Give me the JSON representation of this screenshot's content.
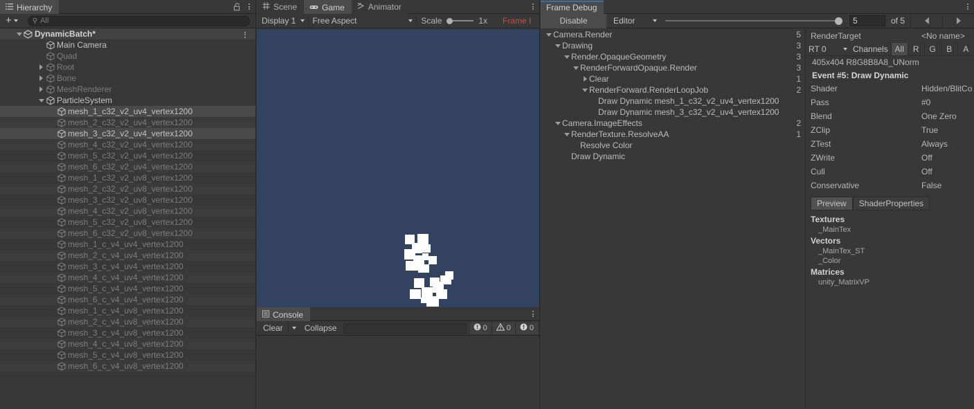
{
  "hierarchy": {
    "tab_label": "Hierarchy",
    "tab_icon": "hierarchy-icon",
    "lock_icon": "lock-icon",
    "menu_icon": "kebab-icon",
    "add_label": "+",
    "search_placeholder": "All",
    "search_value": "",
    "items": [
      {
        "label": "DynamicBatch*",
        "depth": 0,
        "twisty": "down",
        "icon": "scene-icon",
        "state": "root",
        "bold": true,
        "kebab": true
      },
      {
        "label": "Main Camera",
        "depth": 2,
        "twisty": "none",
        "icon": "cube-icon",
        "state": "normal"
      },
      {
        "label": "Quad",
        "depth": 2,
        "twisty": "none",
        "icon": "cube-icon",
        "state": "dim"
      },
      {
        "label": "Root",
        "depth": 2,
        "twisty": "right",
        "icon": "cube-icon",
        "state": "dim"
      },
      {
        "label": "Bone",
        "depth": 2,
        "twisty": "right",
        "icon": "cube-icon",
        "state": "dim"
      },
      {
        "label": "MeshRenderer",
        "depth": 2,
        "twisty": "right",
        "icon": "cube-icon",
        "state": "dim"
      },
      {
        "label": "ParticleSystem",
        "depth": 2,
        "twisty": "down",
        "icon": "cube-icon",
        "state": "normal"
      },
      {
        "label": "mesh_1_c32_v2_uv4_vertex1200",
        "depth": 3,
        "twisty": "none",
        "icon": "cube-icon",
        "state": "sel"
      },
      {
        "label": "mesh_2_c32_v2_uv4_vertex1200",
        "depth": 3,
        "twisty": "none",
        "icon": "cube-icon",
        "state": "dim-zebra"
      },
      {
        "label": "mesh_3_c32_v2_uv4_vertex1200",
        "depth": 3,
        "twisty": "none",
        "icon": "cube-icon",
        "state": "sel"
      },
      {
        "label": "mesh_4_c32_v2_uv4_vertex1200",
        "depth": 3,
        "twisty": "none",
        "icon": "cube-icon",
        "state": "dim-zebra"
      },
      {
        "label": "mesh_5_c32_v2_uv4_vertex1200",
        "depth": 3,
        "twisty": "none",
        "icon": "cube-icon",
        "state": "dim"
      },
      {
        "label": "mesh_6_c32_v2_uv4_vertex1200",
        "depth": 3,
        "twisty": "none",
        "icon": "cube-icon",
        "state": "dim-zebra"
      },
      {
        "label": "mesh_1_c32_v2_uv8_vertex1200",
        "depth": 3,
        "twisty": "none",
        "icon": "cube-icon",
        "state": "dim"
      },
      {
        "label": "mesh_2_c32_v2_uv8_vertex1200",
        "depth": 3,
        "twisty": "none",
        "icon": "cube-icon",
        "state": "dim-zebra"
      },
      {
        "label": "mesh_3_c32_v2_uv8_vertex1200",
        "depth": 3,
        "twisty": "none",
        "icon": "cube-icon",
        "state": "dim"
      },
      {
        "label": "mesh_4_c32_v2_uv8_vertex1200",
        "depth": 3,
        "twisty": "none",
        "icon": "cube-icon",
        "state": "dim-zebra"
      },
      {
        "label": "mesh_5_c32_v2_uv8_vertex1200",
        "depth": 3,
        "twisty": "none",
        "icon": "cube-icon",
        "state": "dim"
      },
      {
        "label": "mesh_6_c32_v2_uv8_vertex1200",
        "depth": 3,
        "twisty": "none",
        "icon": "cube-icon",
        "state": "dim-zebra"
      },
      {
        "label": "mesh_1_c_v4_uv4_vertex1200",
        "depth": 3,
        "twisty": "none",
        "icon": "cube-icon",
        "state": "dim"
      },
      {
        "label": "mesh_2_c_v4_uv4_vertex1200",
        "depth": 3,
        "twisty": "none",
        "icon": "cube-icon",
        "state": "dim-zebra"
      },
      {
        "label": "mesh_3_c_v4_uv4_vertex1200",
        "depth": 3,
        "twisty": "none",
        "icon": "cube-icon",
        "state": "dim"
      },
      {
        "label": "mesh_4_c_v4_uv4_vertex1200",
        "depth": 3,
        "twisty": "none",
        "icon": "cube-icon",
        "state": "dim-zebra"
      },
      {
        "label": "mesh_5_c_v4_uv4_vertex1200",
        "depth": 3,
        "twisty": "none",
        "icon": "cube-icon",
        "state": "dim"
      },
      {
        "label": "mesh_6_c_v4_uv4_vertex1200",
        "depth": 3,
        "twisty": "none",
        "icon": "cube-icon",
        "state": "dim-zebra"
      },
      {
        "label": "mesh_1_c_v4_uv8_vertex1200",
        "depth": 3,
        "twisty": "none",
        "icon": "cube-icon",
        "state": "dim"
      },
      {
        "label": "mesh_2_c_v4_uv8_vertex1200",
        "depth": 3,
        "twisty": "none",
        "icon": "cube-icon",
        "state": "dim-zebra"
      },
      {
        "label": "mesh_3_c_v4_uv8_vertex1200",
        "depth": 3,
        "twisty": "none",
        "icon": "cube-icon",
        "state": "dim"
      },
      {
        "label": "mesh_4_c_v4_uv8_vertex1200",
        "depth": 3,
        "twisty": "none",
        "icon": "cube-icon",
        "state": "dim-zebra"
      },
      {
        "label": "mesh_5_c_v4_uv8_vertex1200",
        "depth": 3,
        "twisty": "none",
        "icon": "cube-icon",
        "state": "dim"
      },
      {
        "label": "mesh_6_c_v4_uv8_vertex1200",
        "depth": 3,
        "twisty": "none",
        "icon": "cube-icon",
        "state": "dim-zebra"
      }
    ]
  },
  "game_panel": {
    "tabs": [
      {
        "label": "Scene",
        "icon": "grid-icon",
        "active": false
      },
      {
        "label": "Game",
        "icon": "gamepad-icon",
        "active": true
      },
      {
        "label": "Animator",
        "icon": "animator-icon",
        "active": false
      }
    ],
    "menu_icon": "kebab-icon",
    "toolbar": {
      "display": "Display 1",
      "aspect": "Free Aspect",
      "scale_label": "Scale",
      "scale_value": "1x",
      "frame_label": "Frame I"
    },
    "view": {
      "background": "#33425f",
      "block_color": "#ffffff"
    }
  },
  "console": {
    "tab_label": "Console",
    "tab_icon": "console-icon",
    "menu_icon": "kebab-icon",
    "clear_label": "Clear",
    "collapse_label": "Collapse",
    "search_value": "",
    "counts": {
      "info": "0",
      "warning": "0",
      "error": "0"
    }
  },
  "frame_debugger": {
    "tab_label": "Frame Debug",
    "menu_icon": "kebab-icon",
    "toolbar": {
      "disable_label": "Disable",
      "target_label": "Editor",
      "event_index": "5",
      "event_total_label": "of 5",
      "prev_icon": "arrow-left-icon",
      "next_icon": "arrow-right-icon"
    },
    "tree": [
      {
        "label": "Camera.Render",
        "depth": 0,
        "twisty": "down",
        "count": "5"
      },
      {
        "label": "Drawing",
        "depth": 1,
        "twisty": "down",
        "count": "3"
      },
      {
        "label": "Render.OpaqueGeometry",
        "depth": 2,
        "twisty": "down",
        "count": "3"
      },
      {
        "label": "RenderForwardOpaque.Render",
        "depth": 3,
        "twisty": "down",
        "count": "3"
      },
      {
        "label": "Clear",
        "depth": 4,
        "twisty": "right",
        "count": "1"
      },
      {
        "label": "RenderForward.RenderLoopJob",
        "depth": 4,
        "twisty": "down",
        "count": "2"
      },
      {
        "label": "Draw Dynamic mesh_1_c32_v2_uv4_vertex1200",
        "depth": 5,
        "twisty": "none",
        "count": ""
      },
      {
        "label": "Draw Dynamic mesh_3_c32_v2_uv4_vertex1200",
        "depth": 5,
        "twisty": "none",
        "count": ""
      },
      {
        "label": "Camera.ImageEffects",
        "depth": 1,
        "twisty": "down",
        "count": "2"
      },
      {
        "label": "RenderTexture.ResolveAA",
        "depth": 2,
        "twisty": "down",
        "count": "1"
      },
      {
        "label": "Resolve Color",
        "depth": 3,
        "twisty": "none",
        "count": ""
      },
      {
        "label": "Draw Dynamic",
        "depth": 2,
        "twisty": "none",
        "count": ""
      }
    ],
    "properties": {
      "render_target_label": "RenderTarget",
      "render_target_value": "<No name>",
      "rt_select": "RT 0",
      "channels_label": "Channels",
      "channels": [
        {
          "label": "All",
          "on": true
        },
        {
          "label": "R",
          "on": false
        },
        {
          "label": "G",
          "on": false
        },
        {
          "label": "B",
          "on": false
        },
        {
          "label": "A",
          "on": false
        }
      ],
      "format_line": "405x404 R8G8B8A8_UNorm",
      "event_title": "Event #5: Draw Dynamic",
      "rows": [
        {
          "key": "Shader",
          "value": "Hidden/BlitCo"
        },
        {
          "key": "Pass",
          "value": "#0"
        },
        {
          "key": "Blend",
          "value": "One Zero"
        },
        {
          "key": "ZClip",
          "value": "True"
        },
        {
          "key": "ZTest",
          "value": "Always"
        },
        {
          "key": "ZWrite",
          "value": "Off"
        },
        {
          "key": "Cull",
          "value": "Off"
        },
        {
          "key": "Conservative",
          "value": "False"
        }
      ],
      "segments": [
        {
          "label": "Preview",
          "on": true
        },
        {
          "label": "ShaderProperties",
          "on": false
        }
      ],
      "sections": [
        {
          "title": "Textures",
          "items": [
            "_MainTex"
          ]
        },
        {
          "title": "Vectors",
          "items": [
            "_MainTex_ST",
            "_Color"
          ]
        },
        {
          "title": "Matrices",
          "items": [
            "unity_MatrixVP"
          ]
        }
      ]
    }
  }
}
